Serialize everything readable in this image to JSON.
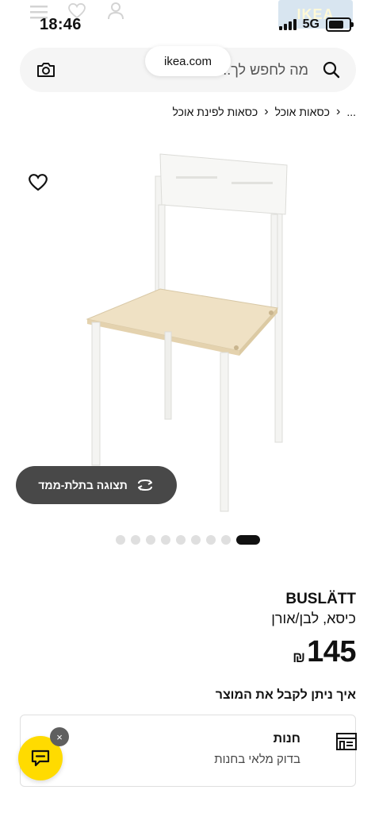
{
  "status_bar": {
    "time": "18:46",
    "network": "5G",
    "battery_level": 0.8
  },
  "header": {
    "logo_text": "IKEA",
    "url": "ikea.com"
  },
  "search": {
    "placeholder": "מה לחפש לך..."
  },
  "breadcrumb": {
    "items": [
      "...",
      "כסאות אוכל",
      "כסאות לפינת אוכל"
    ]
  },
  "gallery": {
    "view_3d_label": "תצוגה בתלת-ממד",
    "image_count": 9,
    "active_index": 8
  },
  "product": {
    "name": "BUSLÄTT",
    "description": "כיסא, לבן/אורן",
    "currency": "₪",
    "price": "145"
  },
  "delivery": {
    "title": "איך ניתן לקבל את המוצר",
    "store_label": "חנות",
    "store_status": "בדוק מלאי בחנות"
  },
  "chat": {
    "close_label": "×"
  },
  "colors": {
    "accent_yellow": "#ffdb00",
    "ikea_blue": "#0058a3",
    "dark_pill": "#484848"
  }
}
